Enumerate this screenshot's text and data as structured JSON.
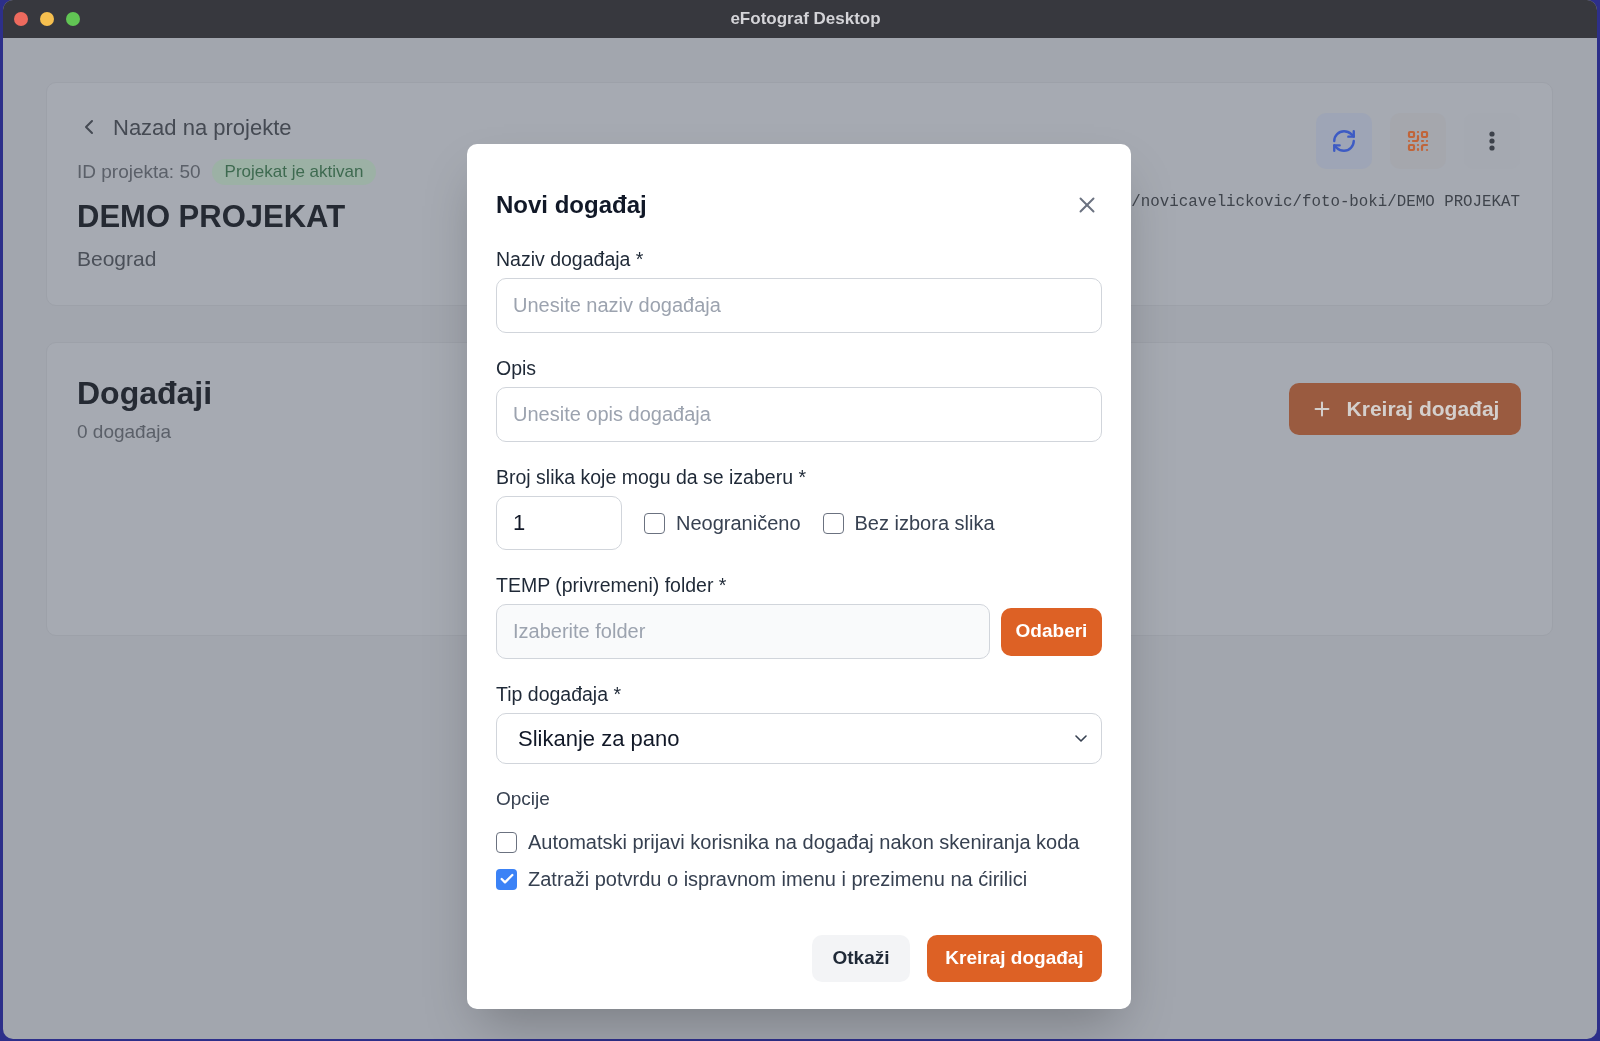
{
  "window": {
    "title": "eFotograf Desktop"
  },
  "project": {
    "back_link": "Nazad na projekte",
    "id_label": "ID projekta: 50",
    "status_badge": "Projekat je aktivan",
    "name": "DEMO PROJEKAT",
    "location": "Beograd",
    "path": "/novicavelickovic/foto-boki/DEMO PROJEKAT"
  },
  "events_section": {
    "title": "Događaji",
    "count": "0 događaja",
    "create_button": "Kreiraj događaj"
  },
  "dialog": {
    "title": "Novi događaj",
    "fields": [
      {
        "kind": "text",
        "label": "Naziv događaja *",
        "placeholder": "Unesite naziv događaja"
      },
      {
        "kind": "text",
        "label": "Opis",
        "placeholder": "Unesite opis događaja"
      },
      {
        "kind": "count",
        "label": "Broj slika koje mogu da se izaberu *",
        "value": "1",
        "checkboxes": [
          {
            "label": "Neograničeno",
            "checked": false
          },
          {
            "label": "Bez izbora slika",
            "checked": false
          }
        ]
      },
      {
        "kind": "folder",
        "label": "TEMP (privremeni) folder *",
        "placeholder": "Izaberite folder",
        "button": "Odaberi"
      },
      {
        "kind": "select",
        "label": "Tip događaja *",
        "value": "Slikanje za pano"
      }
    ],
    "options": {
      "label": "Opcije",
      "items": [
        {
          "label": "Automatski prijavi korisnika na događaj nakon skeniranja koda",
          "checked": false
        },
        {
          "label": "Zatraži potvrdu o ispravnom imenu i prezimenu na ćirilici",
          "checked": true
        }
      ]
    },
    "buttons": [
      {
        "kind": "secondary",
        "label": "Otkaži"
      },
      {
        "kind": "primary",
        "label": "Kreiraj događaj"
      }
    ]
  }
}
